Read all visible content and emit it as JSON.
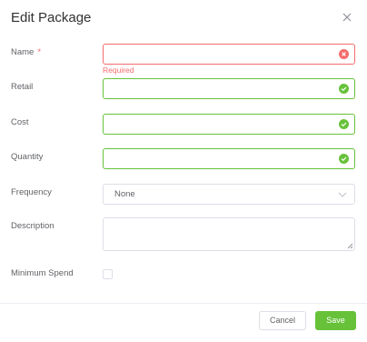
{
  "dialog": {
    "title": "Edit Package",
    "close_icon": "close-icon"
  },
  "form": {
    "name": {
      "label": "Name",
      "required_mark": "*",
      "value": "",
      "error": "Required",
      "status_icon": "error-circle-icon"
    },
    "retail": {
      "label": "Retail",
      "value": "",
      "status_icon": "check-circle-icon"
    },
    "cost": {
      "label": "Cost",
      "value": "",
      "status_icon": "check-circle-icon"
    },
    "quantity": {
      "label": "Quantity",
      "value": "",
      "status_icon": "check-circle-icon"
    },
    "frequency": {
      "label": "Frequency",
      "selected": "None",
      "arrow_icon": "chevron-down-icon"
    },
    "description": {
      "label": "Description",
      "value": ""
    },
    "minimum_spend": {
      "label": "Minimum Spend",
      "checked": false
    }
  },
  "footer": {
    "cancel_label": "Cancel",
    "save_label": "Save"
  },
  "colors": {
    "error": "#f56c6c",
    "success": "#67c23a",
    "border": "#dcdfe6",
    "title": "#303133",
    "text": "#606266"
  }
}
